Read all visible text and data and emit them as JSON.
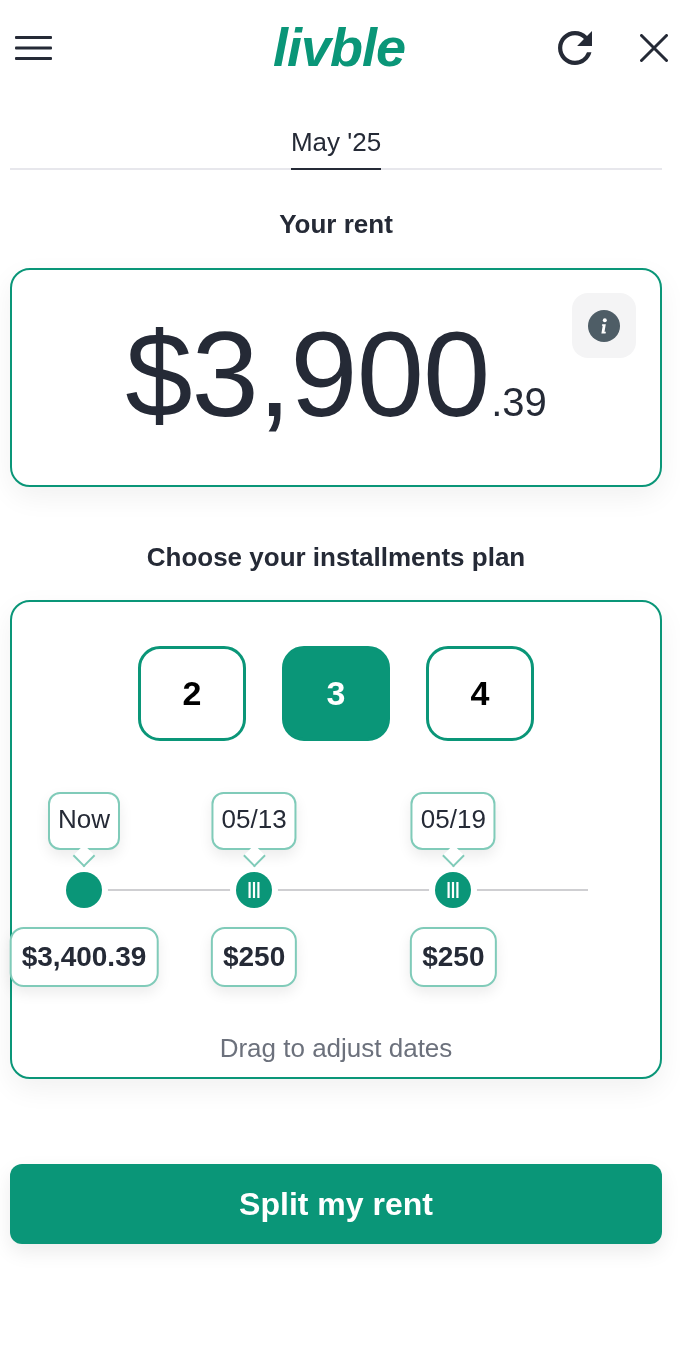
{
  "header": {
    "logo": "livble"
  },
  "tabs": [
    {
      "label": "May '25",
      "selected": true
    }
  ],
  "rent": {
    "title": "Your rent",
    "amount": "$3,900",
    "cents": ".39"
  },
  "plan": {
    "title": "Choose your installments plan",
    "options": [
      {
        "label": "2",
        "selected": false
      },
      {
        "label": "3",
        "selected": true
      },
      {
        "label": "4",
        "selected": false
      }
    ],
    "installments": [
      {
        "kind": "fixed",
        "date": "Now",
        "amount": "$3,400.39",
        "level": 0
      },
      {
        "kind": "draggable",
        "date": "05/13",
        "amount": "$250",
        "level": 0.35
      },
      {
        "kind": "draggable",
        "date": "05/19",
        "amount": "$250",
        "level": 0.76
      }
    ],
    "hint": "Drag to adjust dates"
  },
  "submit": {
    "label": "Split my rent"
  }
}
